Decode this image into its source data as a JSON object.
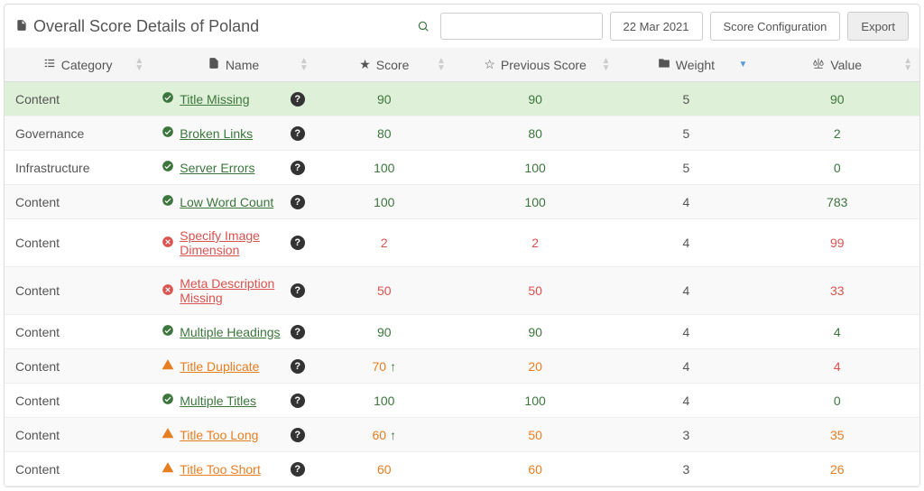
{
  "header": {
    "title": "Overall Score Details of Poland",
    "date_label": "22 Mar 2021",
    "config_label": "Score Configuration",
    "export_label": "Export",
    "search_placeholder": ""
  },
  "columns": {
    "category": "Category",
    "name": "Name",
    "score": "Score",
    "previous": "Previous Score",
    "weight": "Weight",
    "value": "Value"
  },
  "rows": [
    {
      "highlight": true,
      "category": "Content",
      "status": "ok",
      "name": "Title Missing",
      "score": 90,
      "score_trend": "",
      "prev": 90,
      "weight": 5,
      "value": 90,
      "value_class": "score-green"
    },
    {
      "highlight": false,
      "category": "Governance",
      "status": "ok",
      "name": "Broken Links",
      "score": 80,
      "score_trend": "",
      "prev": 80,
      "weight": 5,
      "value": 2,
      "value_class": "score-green"
    },
    {
      "highlight": false,
      "category": "Infrastructure",
      "status": "ok",
      "name": "Server Errors",
      "score": 100,
      "score_trend": "",
      "prev": 100,
      "weight": 5,
      "value": 0,
      "value_class": "score-green"
    },
    {
      "highlight": false,
      "category": "Content",
      "status": "ok",
      "name": "Low Word Count",
      "score": 100,
      "score_trend": "",
      "prev": 100,
      "weight": 4,
      "value": 783,
      "value_class": "score-green"
    },
    {
      "highlight": false,
      "category": "Content",
      "status": "err",
      "name": "Specify Image Dimension",
      "score": 2,
      "score_trend": "",
      "prev": 2,
      "weight": 4,
      "value": 99,
      "value_class": "score-red"
    },
    {
      "highlight": false,
      "category": "Content",
      "status": "err",
      "name": "Meta Description Missing",
      "score": 50,
      "score_trend": "",
      "prev": 50,
      "weight": 4,
      "value": 33,
      "value_class": "score-red"
    },
    {
      "highlight": false,
      "category": "Content",
      "status": "ok",
      "name": "Multiple Headings",
      "score": 90,
      "score_trend": "",
      "prev": 90,
      "weight": 4,
      "value": 4,
      "value_class": "score-green"
    },
    {
      "highlight": false,
      "category": "Content",
      "status": "warn",
      "name": "Title Duplicate",
      "score": 70,
      "score_trend": "up",
      "prev": 20,
      "weight": 4,
      "value": 4,
      "value_class": "score-red"
    },
    {
      "highlight": false,
      "category": "Content",
      "status": "ok",
      "name": "Multiple Titles",
      "score": 100,
      "score_trend": "",
      "prev": 100,
      "weight": 4,
      "value": 0,
      "value_class": "score-green"
    },
    {
      "highlight": false,
      "category": "Content",
      "status": "warn",
      "name": "Title Too Long",
      "score": 60,
      "score_trend": "up",
      "prev": 50,
      "weight": 3,
      "value": 35,
      "value_class": "score-orange"
    },
    {
      "highlight": false,
      "category": "Content",
      "status": "warn",
      "name": "Title Too Short",
      "score": 60,
      "score_trend": "",
      "prev": 60,
      "weight": 3,
      "value": 26,
      "value_class": "score-orange"
    }
  ],
  "status_color": {
    "ok": {
      "link": "status-ok",
      "score": "score-green"
    },
    "warn": {
      "link": "status-warn",
      "score": "score-orange"
    },
    "err": {
      "link": "status-err",
      "score": "score-red"
    }
  }
}
